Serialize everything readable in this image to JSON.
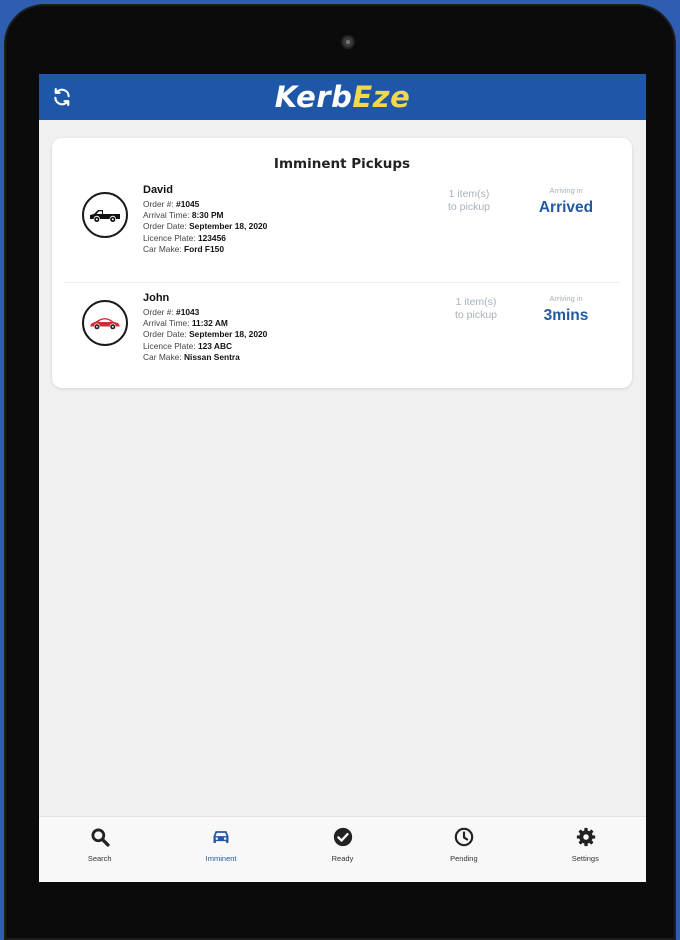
{
  "app": {
    "brand_part1": "Kerb",
    "brand_part2": "Eze",
    "refresh_icon": "refresh-icon",
    "colors": {
      "appbar": "#1e56a8",
      "brand_accent": "#f3d84a",
      "status_blue": "#2259a3",
      "muted": "#a7b1bd"
    }
  },
  "card": {
    "title": "Imminent Pickups",
    "pickups": [
      {
        "name": "David",
        "order_label": "Order #: ",
        "order": "#1045",
        "arrival_label": "Arrival Time: ",
        "arrival": "8:30 PM",
        "date_label": "Order Date: ",
        "date": "September 18, 2020",
        "plate_label": "Licence Plate: ",
        "plate": "123456",
        "make_label": "Car Make: ",
        "make": "Ford F150",
        "items_line1": "1 item(s)",
        "items_line2": "to pickup",
        "arriving_label": "Arriving in",
        "arriving_value": "Arrived",
        "vehicle_icon": "pickup-truck-icon",
        "vehicle_color": "#111111"
      },
      {
        "name": "John",
        "order_label": "Order #: ",
        "order": "#1043",
        "arrival_label": "Arrival Time: ",
        "arrival": "11:32 AM",
        "date_label": "Order Date: ",
        "date": "September 18, 2020",
        "plate_label": "Licence Plate: ",
        "plate": "123 ABC",
        "make_label": "Car Make: ",
        "make": "Nissan Sentra",
        "items_line1": "1 item(s)",
        "items_line2": "to pickup",
        "arriving_label": "Arriving in",
        "arriving_value": "3mins",
        "vehicle_icon": "sedan-car-icon",
        "vehicle_color": "#d62a36"
      }
    ]
  },
  "tabs": [
    {
      "label": "Search",
      "icon": "search-icon"
    },
    {
      "label": "Imminent",
      "icon": "car-icon",
      "active": true
    },
    {
      "label": "Ready",
      "icon": "check-circle-icon"
    },
    {
      "label": "Pending",
      "icon": "clock-icon"
    },
    {
      "label": "Settings",
      "icon": "gear-icon"
    }
  ]
}
